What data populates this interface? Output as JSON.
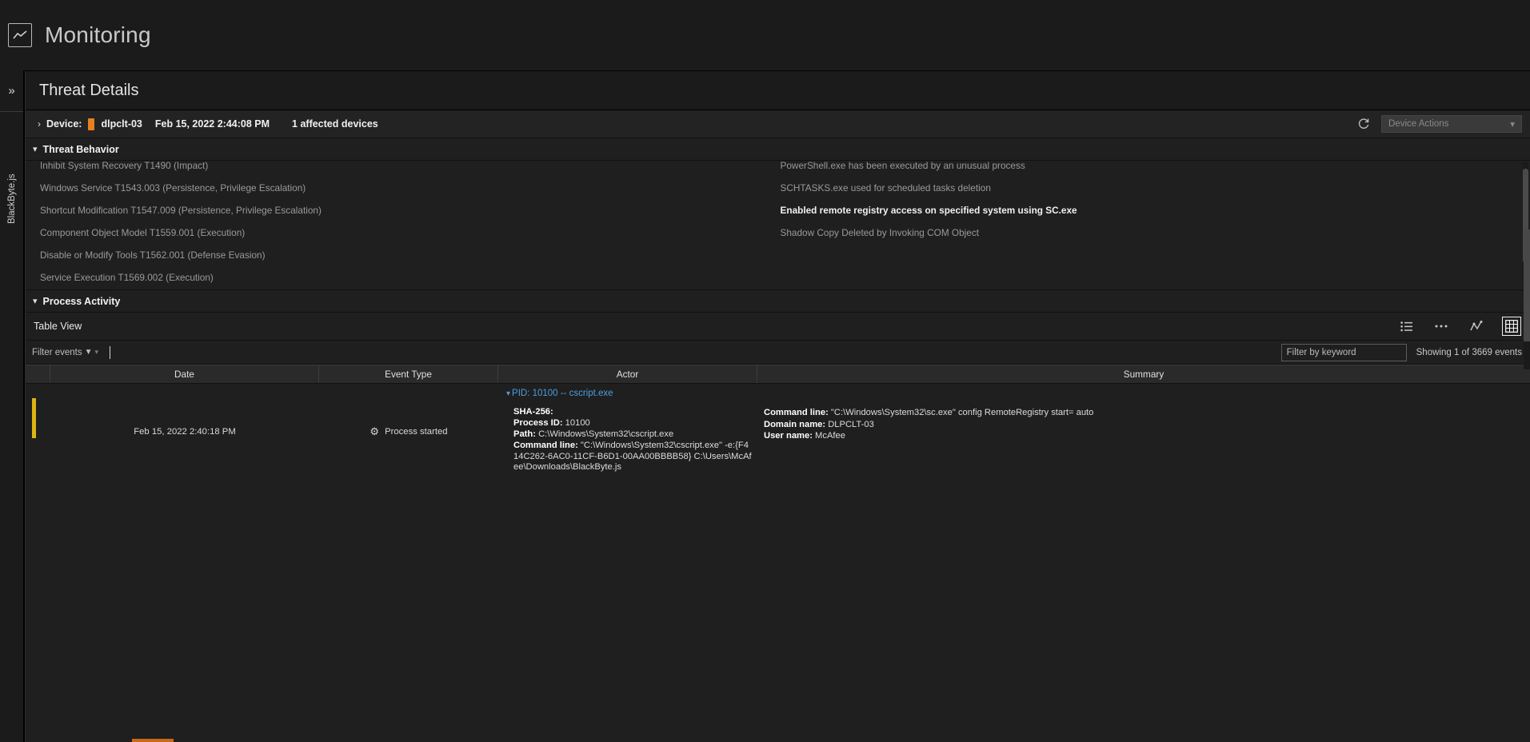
{
  "app": {
    "title": "Monitoring",
    "icon": "chart-line-icon"
  },
  "rail": {
    "expand_icon": "double-chevron-right-icon",
    "tab_label": "BlackByte.js"
  },
  "panel": {
    "title": "Threat Details"
  },
  "device": {
    "expand_icon": "chevron-right-icon",
    "label": "Device:",
    "severity_color": "#e8801f",
    "name": "dlpclt-03",
    "timestamp": "Feb 15, 2022 2:44:08 PM",
    "affected": "1 affected devices",
    "refresh_icon": "refresh-icon",
    "actions_button": "Device Actions",
    "actions_caret_icon": "chevron-down-icon"
  },
  "threat_behavior": {
    "caret_icon": "chevron-down-icon",
    "title": "Threat Behavior",
    "left": [
      "Inhibit System Recovery T1490 (Impact)",
      "Windows Service T1543.003 (Persistence, Privilege Escalation)",
      "Shortcut Modification T1547.009 (Persistence, Privilege Escalation)",
      "Component Object Model T1559.001 (Execution)",
      "Disable or Modify Tools T1562.001 (Defense Evasion)",
      "Service Execution T1569.002 (Execution)"
    ],
    "right": [
      "PowerShell.exe has been executed by an unusual process",
      "SCHTASKS.exe used for scheduled tasks deletion",
      "Enabled remote registry access on specified system using SC.exe",
      "Shadow Copy Deleted by Invoking COM Object"
    ],
    "right_emphasis_index": 2
  },
  "process_activity": {
    "caret_icon": "chevron-down-icon",
    "title": "Process Activity",
    "view_label": "Table View",
    "view_icons": [
      {
        "name": "list-view-icon",
        "active": false
      },
      {
        "name": "ellipsis-icon",
        "active": false
      },
      {
        "name": "graph-view-icon",
        "active": false
      },
      {
        "name": "table-view-icon",
        "active": true
      }
    ],
    "filter": {
      "events_label": "Filter events",
      "funnel_icon": "funnel-icon",
      "dropdown_icon": "chevron-down-icon",
      "keyword_placeholder": "Filter by keyword",
      "keyword_value": "",
      "showing": "Showing 1 of 3669 events"
    },
    "table": {
      "columns": [
        "",
        "Date",
        "Event Type",
        "Actor",
        "Summary"
      ],
      "rows": [
        {
          "marker_color": "#ddb413",
          "date": "Feb 15, 2022 2:40:18 PM",
          "event_type": "Process started",
          "event_type_icon": "gear-icon",
          "actor": {
            "pid_line": "PID: 10100 -- cscript.exe",
            "pid_caret_icon": "chevron-down-icon",
            "fields": [
              {
                "key": "SHA-256:",
                "value": ""
              },
              {
                "key": "Process ID:",
                "value": "10100"
              },
              {
                "key": "Path:",
                "value": "C:\\Windows\\System32\\cscript.exe"
              },
              {
                "key": "Command line:",
                "value": "\"C:\\Windows\\System32\\cscript.exe\" -e:{F414C262-6AC0-11CF-B6D1-00AA00BBBB58} C:\\Users\\McAfee\\Downloads\\BlackByte.js"
              }
            ]
          },
          "summary": {
            "fields": [
              {
                "key": "Command line:",
                "value": "\"C:\\Windows\\System32\\sc.exe\" config RemoteRegistry start= auto"
              },
              {
                "key": "Domain name:",
                "value": "DLPCLT-03"
              },
              {
                "key": "User name:",
                "value": "McAfee"
              }
            ]
          }
        }
      ]
    }
  },
  "colors": {
    "accent_orange": "#e8801f",
    "link_blue": "#4a9fe0",
    "marker_yellow": "#ddb413",
    "bottom_accent": "#c86a1a"
  }
}
